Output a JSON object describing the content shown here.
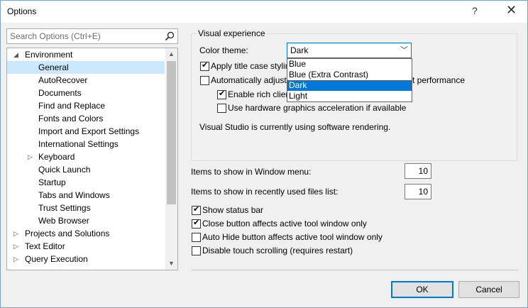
{
  "window": {
    "title": "Options",
    "help_glyph": "?",
    "close_glyph": "✕"
  },
  "search": {
    "placeholder": "Search Options (Ctrl+E)"
  },
  "tree": {
    "items": [
      {
        "label": "Environment",
        "expander": "◢"
      },
      {
        "label": "General",
        "selected": true
      },
      {
        "label": "AutoRecover"
      },
      {
        "label": "Documents"
      },
      {
        "label": "Find and Replace"
      },
      {
        "label": "Fonts and Colors"
      },
      {
        "label": "Import and Export Settings"
      },
      {
        "label": "International Settings"
      },
      {
        "label": "Keyboard",
        "expander": "▷"
      },
      {
        "label": "Quick Launch"
      },
      {
        "label": "Startup"
      },
      {
        "label": "Tabs and Windows"
      },
      {
        "label": "Trust Settings"
      },
      {
        "label": "Web Browser"
      },
      {
        "label": "Projects and Solutions",
        "expander": "▷"
      },
      {
        "label": "Text Editor",
        "expander": "▷"
      },
      {
        "label": "Query Execution",
        "expander": "▷"
      }
    ]
  },
  "visual_experience": {
    "group_label": "Visual experience",
    "color_theme_label": "Color theme:",
    "color_theme_value": "Dark",
    "options": [
      "Blue",
      "Blue (Extra Contrast)",
      "Dark",
      "Light"
    ],
    "apply_title_case": "Apply title case styling",
    "auto_adjust_prefix": "Automatically adjust",
    "auto_adjust_suffix": "t performance",
    "enable_rich_client": "Enable rich client",
    "hw_accel": "Use hardware graphics acceleration if available",
    "status_text": "Visual Studio is currently using software rendering."
  },
  "window_menu": {
    "label": "Items to show in Window menu:",
    "value": "10"
  },
  "recent_files": {
    "label": "Items to show in recently used files list:",
    "value": "10"
  },
  "checkboxes": {
    "show_status_bar": "Show status bar",
    "close_button": "Close button affects active tool window only",
    "auto_hide": "Auto Hide button affects active tool window only",
    "disable_touch": "Disable touch scrolling (requires restart)"
  },
  "buttons": {
    "ok": "OK",
    "cancel": "Cancel"
  }
}
